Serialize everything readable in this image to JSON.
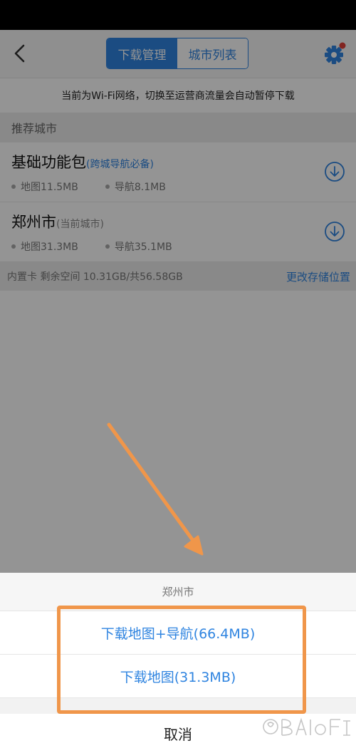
{
  "header": {
    "tabs": [
      {
        "label": "下载管理",
        "active": true
      },
      {
        "label": "城市列表",
        "active": false
      }
    ]
  },
  "notice": "当前为Wi-Fi网络，切换至运营商流量会自动暂停下载",
  "section_title": "推荐城市",
  "cities": [
    {
      "name": "基础功能包",
      "tag": "(跨城导航必备)",
      "map_size": "地图11.5MB",
      "nav_size": "导航8.1MB"
    },
    {
      "name": "郑州市",
      "tag": "(当前城市)",
      "map_size": "地图31.3MB",
      "nav_size": "导航35.1MB"
    }
  ],
  "storage": {
    "info": "内置卡 剩余空间 10.31GB/共56.58GB",
    "change_label": "更改存储位置"
  },
  "sheet": {
    "title": "郑州市",
    "option_map_nav": "下载地图+导航(66.4MB)",
    "option_map": "下载地图(31.3MB)",
    "cancel": "取消"
  },
  "colors": {
    "accent": "#2f84e0",
    "annotation": "#f0964a",
    "badge": "#e0403a"
  }
}
